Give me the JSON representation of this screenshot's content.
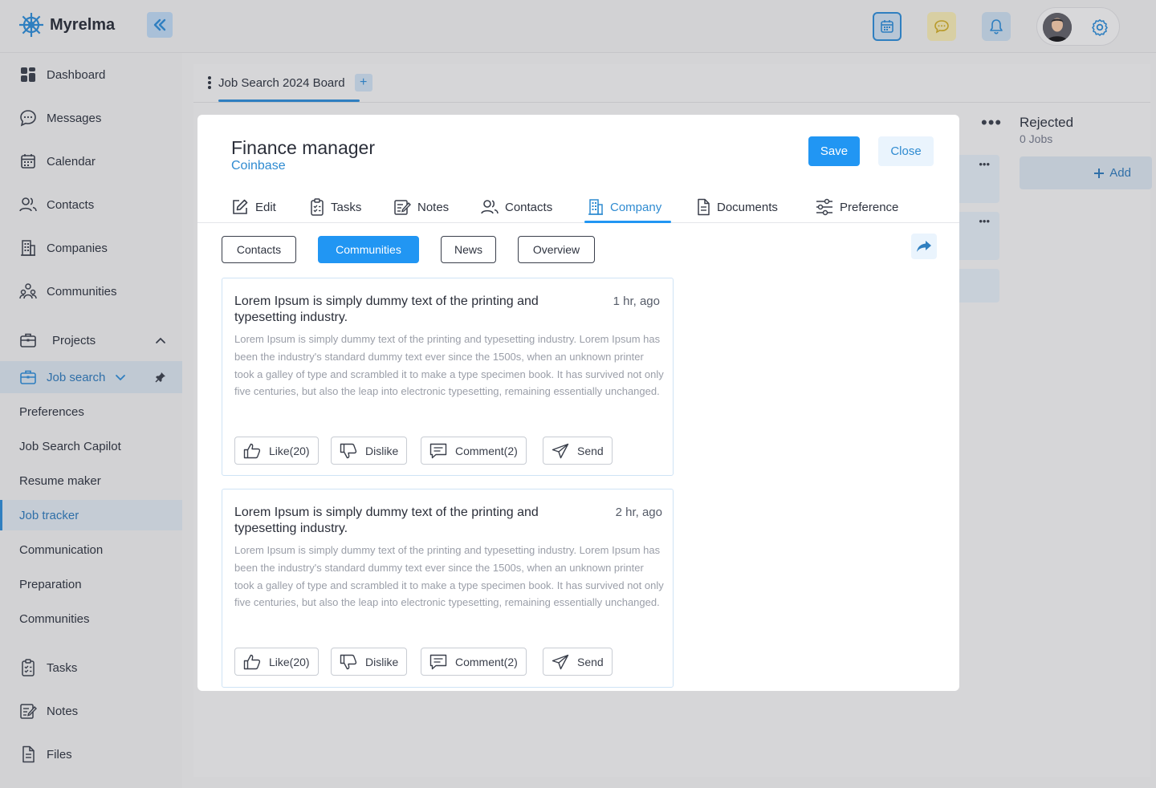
{
  "app": {
    "name": "Myrelma",
    "collapse_icon": "double-chevron-left-icon"
  },
  "topbar": {
    "icons": [
      "calendar-icon",
      "chat-icon",
      "bell-icon",
      "settings-icon"
    ],
    "accent": "#2f7fc0"
  },
  "sidebar": {
    "items": [
      {
        "label": "Dashboard",
        "icon": "dashboard-icon"
      },
      {
        "label": "Messages",
        "icon": "chat-bubble-icon"
      },
      {
        "label": "Calendar",
        "icon": "calendar-icon"
      },
      {
        "label": "Contacts",
        "icon": "users-icon"
      },
      {
        "label": "Companies",
        "icon": "building-icon"
      },
      {
        "label": "Communities",
        "icon": "community-icon"
      }
    ],
    "projects_label": "Projects",
    "job_search_label": "Job search",
    "sub_items": [
      "Preferences",
      "Job Search Capilot",
      "Resume maker",
      "Job tracker",
      "Communication",
      "Preparation",
      "Communities"
    ],
    "bottom_items": [
      {
        "label": "Tasks",
        "icon": "clipboard-icon"
      },
      {
        "label": "Notes",
        "icon": "notes-icon"
      },
      {
        "label": "Files",
        "icon": "file-icon"
      }
    ]
  },
  "board": {
    "tab_label": "Job Search 2024 Board",
    "add_tab": "+",
    "column_title": "Rejected",
    "column_count": "0 Jobs",
    "add_label": "Add"
  },
  "modal": {
    "title": "Finance manager",
    "company": "Coinbase",
    "save_label": "Save",
    "close_label": "Close",
    "tabs": [
      "Edit",
      "Tasks",
      "Notes",
      "Contacts",
      "Company",
      "Documents",
      "Preference"
    ],
    "active_tab": "Company",
    "subtabs": [
      "Contacts",
      "Communities",
      "News",
      "Overview"
    ],
    "active_subtab": "Communities",
    "posts": [
      {
        "title": "Lorem Ipsum is simply dummy text of the printing and typesetting industry.",
        "time": "1 hr, ago",
        "body": "Lorem Ipsum is simply dummy text of the printing and typesetting industry. Lorem Ipsum has been the industry's standard dummy text ever since the 1500s, when an unknown printer took a galley of type and scrambled it to make a type specimen book. It has survived not only five centuries, but also the leap into electronic typesetting, remaining essentially unchanged.",
        "like": "Like(20)",
        "dislike": "Dislike",
        "comment": "Comment(2)",
        "send": "Send"
      },
      {
        "title": "Lorem Ipsum is simply dummy text of the printing and typesetting industry.",
        "time": "2 hr, ago",
        "body": "Lorem Ipsum is simply dummy text of the printing and typesetting industry. Lorem Ipsum has been the industry's standard dummy text ever since the 1500s, when an unknown printer took a galley of type and scrambled it to make a type specimen book. It has survived not only five centuries, but also the leap into electronic typesetting, remaining essentially unchanged.",
        "like": "Like(20)",
        "dislike": "Dislike",
        "comment": "Comment(2)",
        "send": "Send"
      }
    ]
  }
}
